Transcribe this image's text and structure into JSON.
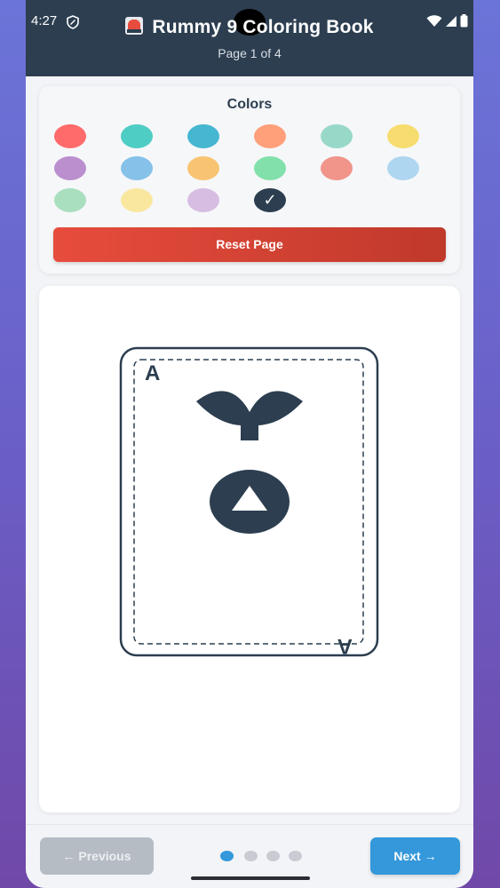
{
  "status_bar": {
    "time": "4:27",
    "icons": [
      "shield-icon",
      "wifi-icon",
      "signal-icon",
      "battery-icon"
    ]
  },
  "header": {
    "title": "Rummy 9 Coloring Book",
    "title_icon": "card-game-icon",
    "page_indicator": "Page 1 of 4"
  },
  "palette": {
    "title": "Colors",
    "colors": [
      {
        "name": "red",
        "hex": "#ff6b6b"
      },
      {
        "name": "turquoise",
        "hex": "#4ecdc4"
      },
      {
        "name": "blue",
        "hex": "#45b7d1"
      },
      {
        "name": "salmon",
        "hex": "#ffa07a"
      },
      {
        "name": "mint",
        "hex": "#98d8c8"
      },
      {
        "name": "yellow",
        "hex": "#f7dc6f"
      },
      {
        "name": "purple",
        "hex": "#bb8fce"
      },
      {
        "name": "sky-blue",
        "hex": "#85c1e9"
      },
      {
        "name": "orange",
        "hex": "#f8c471"
      },
      {
        "name": "green",
        "hex": "#82e0aa"
      },
      {
        "name": "coral",
        "hex": "#f1948a"
      },
      {
        "name": "light-blue",
        "hex": "#aed6f1"
      },
      {
        "name": "pale-green",
        "hex": "#a9dfbf"
      },
      {
        "name": "pale-yellow",
        "hex": "#f9e79f"
      },
      {
        "name": "lavender",
        "hex": "#d7bde2"
      },
      {
        "name": "dark-navy",
        "hex": "#2c3e50"
      }
    ],
    "selected_index": 15,
    "selected_mark": "✓",
    "reset_label": "Reset Page"
  },
  "canvas": {
    "card_rank": "A",
    "suit": "spade",
    "stroke_color": "#2c3e50"
  },
  "footer": {
    "prev_label": "← Previous",
    "next_label": "Next →",
    "current_page": 1,
    "total_pages": 4
  }
}
